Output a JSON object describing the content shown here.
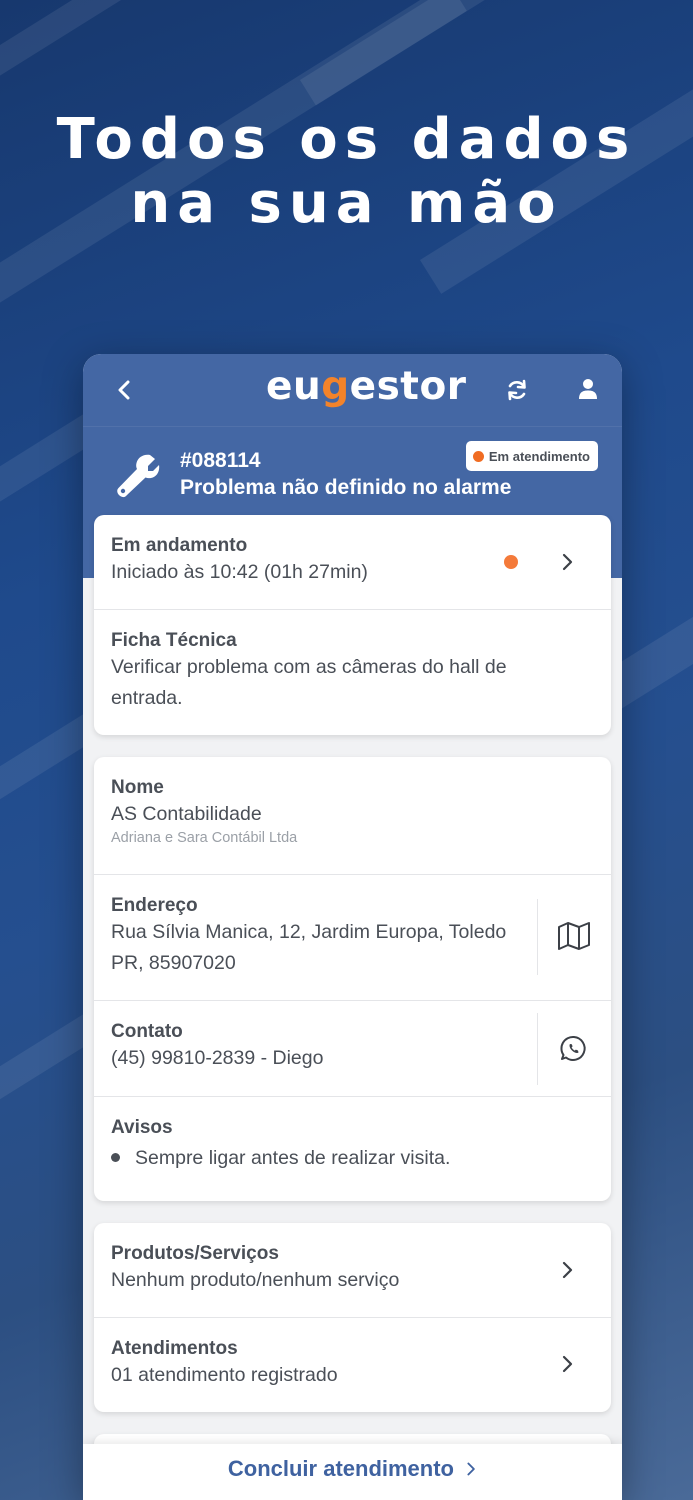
{
  "headline": {
    "line1": "Todos os dados",
    "line2": "na sua mão"
  },
  "app": {
    "logo_prefix": "eu",
    "logo_accent": "g",
    "logo_suffix": "estor",
    "accent_color": "#f3832a",
    "header_color": "#4467a4"
  },
  "order": {
    "number": "#088114",
    "title": "Problema não definido no alarme",
    "status_badge": "Em atendimento",
    "status_color": "#f06c22"
  },
  "progress": {
    "label": "Em andamento",
    "value": "Iniciado às 10:42 (01h 27min)"
  },
  "technical_sheet": {
    "label": "Ficha Técnica",
    "value_line1": "Verificar problema com as câmeras do hall de",
    "value_line2": "entrada."
  },
  "client": {
    "name_label": "Nome",
    "name": "AS Contabilidade",
    "legal_name": "Adriana e Sara Contábil Ltda",
    "address_label": "Endereço",
    "address_line1": "Rua Sílvia Manica, 12, Jardim Europa, Toledo",
    "address_line2": "PR, 85907020",
    "contact_label": "Contato",
    "contact": "(45) 99810-2839 - Diego",
    "notices_label": "Avisos",
    "notice_item": "Sempre ligar antes de realizar visita."
  },
  "products": {
    "label": "Produtos/Serviços",
    "value": "Nenhum produto/nenhum serviço"
  },
  "visits": {
    "label": "Atendimentos",
    "value": "01 atendimento registrado"
  },
  "actions": {
    "conclude": "Concluir atendimento"
  },
  "icons": {
    "back": "chevron-left-icon",
    "refresh": "refresh-icon",
    "user": "user-icon",
    "wrench": "wrench-icon",
    "map": "map-icon",
    "whatsapp": "whatsapp-icon",
    "chevron": "chevron-right-icon"
  }
}
